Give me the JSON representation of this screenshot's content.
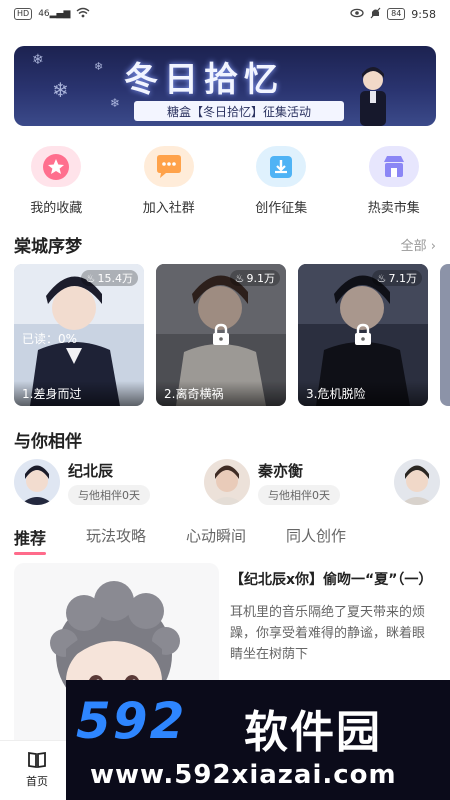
{
  "status_bar": {
    "left_chip": "HD",
    "signal": "46",
    "battery": "84",
    "time": "9:58"
  },
  "banner": {
    "title": "冬日拾忆",
    "subtitle": "糖盒【冬日拾忆】征集活动"
  },
  "quick_nav": [
    {
      "label": "我的收藏",
      "icon": "star-icon",
      "color": "#ff6f8e"
    },
    {
      "label": "加入社群",
      "icon": "chat-bubble-icon",
      "color": "#ffa24a"
    },
    {
      "label": "创作征集",
      "icon": "download-tray-icon",
      "color": "#4fb3f5"
    },
    {
      "label": "热卖市集",
      "icon": "shop-icon",
      "color": "#8b86f5"
    }
  ],
  "stories": {
    "title": "棠城序梦",
    "more": "全部",
    "cards": [
      {
        "views": "15.4万",
        "caption": "1.差身而过",
        "read": "已读：0%",
        "locked": false
      },
      {
        "views": "9.1万",
        "caption": "2.离奇横祸",
        "locked": true
      },
      {
        "views": "7.1万",
        "caption": "3.危机脱险",
        "locked": true
      }
    ]
  },
  "companions": {
    "title": "与你相伴",
    "items": [
      {
        "name": "纪北辰",
        "badge": "与他相伴0天"
      },
      {
        "name": "秦亦衡",
        "badge": "与他相伴0天"
      }
    ]
  },
  "tabs": [
    "推荐",
    "玩法攻略",
    "心动瞬间",
    "同人创作"
  ],
  "feed": {
    "title": "【纪北辰x你】偷吻一“夏”（一）",
    "body": "耳机里的音乐隔绝了夏天带来的烦躁，你享受着难得的静谧，眯着眼睛坐在树荫下"
  },
  "bottom_nav": {
    "home_label": "首页"
  },
  "watermark": {
    "logo": "592",
    "cn": "软件园",
    "url": "www.592xiazai.com"
  }
}
